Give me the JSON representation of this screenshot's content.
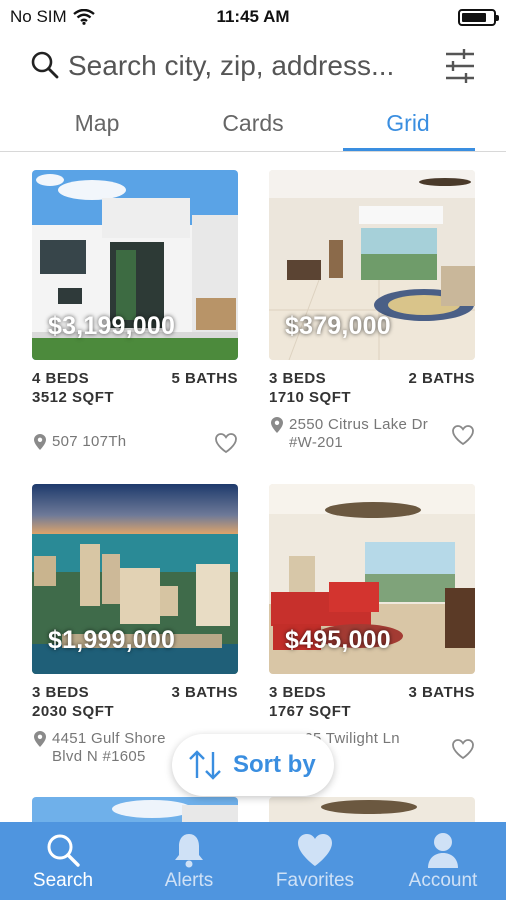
{
  "status_bar": {
    "carrier": "No SIM",
    "time": "11:45 AM",
    "battery_level": 0.8
  },
  "search": {
    "placeholder": "Search city, zip, address..."
  },
  "tabs": [
    {
      "label": "Map",
      "active": false
    },
    {
      "label": "Cards",
      "active": false
    },
    {
      "label": "Grid",
      "active": true
    }
  ],
  "listings": [
    {
      "price": "$3,199,000",
      "beds": "4 BEDS",
      "baths": "5 BATHS",
      "sqft": "3512 SQFT",
      "address_line1": "507 107Th",
      "address_line2": ""
    },
    {
      "price": "$379,000",
      "beds": "3 BEDS",
      "baths": "2 BATHS",
      "sqft": "1710 SQFT",
      "address_line1": "2550 Citrus Lake Dr",
      "address_line2": "#W-201"
    },
    {
      "price": "$1,999,000",
      "beds": "3 BEDS",
      "baths": "3 BATHS",
      "sqft": "2030 SQFT",
      "address_line1": "4451 Gulf Shore",
      "address_line2": "Blvd N #1605"
    },
    {
      "price": "$495,000",
      "beds": "3 BEDS",
      "baths": "3 BATHS",
      "sqft": "1767 SQFT",
      "address_line1": "…65 Twilight Ln",
      "address_line2": ""
    }
  ],
  "sort_button": {
    "label": "Sort by"
  },
  "bottom_nav": [
    {
      "label": "Search",
      "icon": "search-icon",
      "active": true
    },
    {
      "label": "Alerts",
      "icon": "bell-icon",
      "active": false
    },
    {
      "label": "Favorites",
      "icon": "heart-icon",
      "active": false
    },
    {
      "label": "Account",
      "icon": "person-icon",
      "active": false
    }
  ],
  "colors": {
    "accent": "#3a8ee0",
    "nav_background": "#4f95df"
  }
}
